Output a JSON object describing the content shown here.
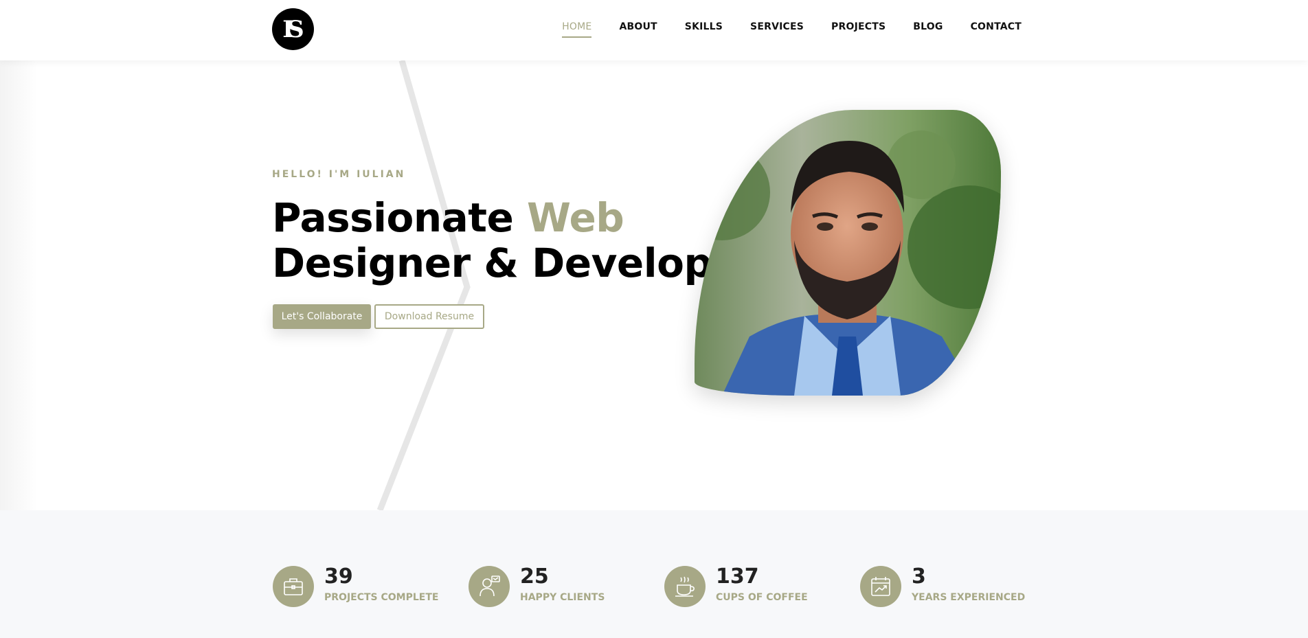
{
  "header": {
    "logo_text": "IS",
    "nav": [
      {
        "label": "HOME",
        "active": true
      },
      {
        "label": "ABOUT"
      },
      {
        "label": "SKILLS"
      },
      {
        "label": "SERVICES"
      },
      {
        "label": "PROJECTS"
      },
      {
        "label": "BLOG"
      },
      {
        "label": "CONTACT"
      }
    ]
  },
  "hero": {
    "kicker": "HELLO! I'M IULIAN",
    "title_part1": "Passionate ",
    "title_accent": "Web",
    "title_line2": "Designer & Developer",
    "primary_button": "Let's Collaborate",
    "secondary_button": "Download Resume"
  },
  "stats": [
    {
      "number": "39",
      "label": "PROJECTS COMPLETE",
      "icon": "briefcase-icon"
    },
    {
      "number": "25",
      "label": "HAPPY CLIENTS",
      "icon": "client-icon"
    },
    {
      "number": "137",
      "label": "CUPS OF COFFEE",
      "icon": "coffee-icon"
    },
    {
      "number": "3",
      "label": "YEARS EXPERIENCED",
      "icon": "calendar-chart-icon"
    }
  ],
  "colors": {
    "accent": "#a7a886",
    "stats_background": "#f7f8fa",
    "text": "#000000"
  }
}
